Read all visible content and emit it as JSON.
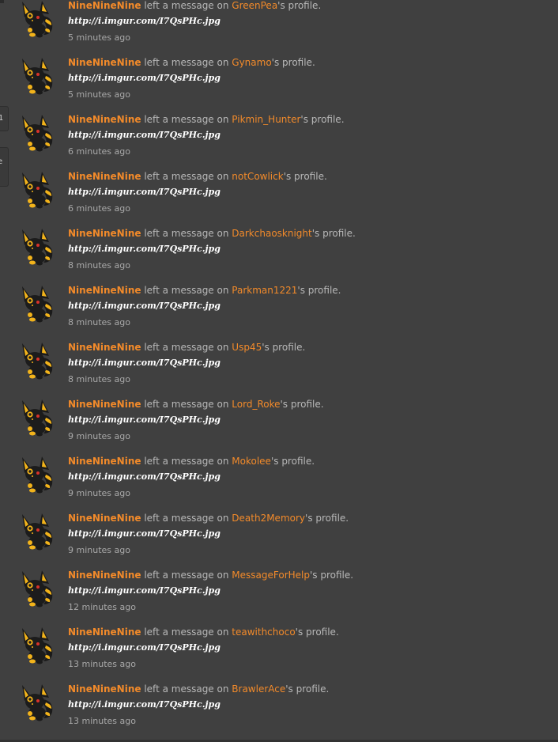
{
  "sidebar_fragments": {
    "tab1": "1",
    "tab2_line1": "e",
    "tab2_line2": ")"
  },
  "feed": [
    {
      "author": "NineNineNine",
      "action": "left a message on",
      "target": "GreenPea",
      "suffix": "'s profile.",
      "message": "http://i.imgur.com/I7QsPHc.jpg",
      "time": "5 minutes ago"
    },
    {
      "author": "NineNineNine",
      "action": "left a message on",
      "target": "Gynamo",
      "suffix": "'s profile.",
      "message": "http://i.imgur.com/I7QsPHc.jpg",
      "time": "5 minutes ago"
    },
    {
      "author": "NineNineNine",
      "action": "left a message on",
      "target": "Pikmin_Hunter",
      "suffix": "'s profile.",
      "message": "http://i.imgur.com/I7QsPHc.jpg",
      "time": "6 minutes ago"
    },
    {
      "author": "NineNineNine",
      "action": "left a message on",
      "target": "notCowlick",
      "suffix": "'s profile.",
      "message": "http://i.imgur.com/I7QsPHc.jpg",
      "time": "6 minutes ago"
    },
    {
      "author": "NineNineNine",
      "action": "left a message on",
      "target": "Darkchaosknight",
      "suffix": "'s profile.",
      "message": "http://i.imgur.com/I7QsPHc.jpg",
      "time": "8 minutes ago"
    },
    {
      "author": "NineNineNine",
      "action": "left a message on",
      "target": "Parkman1221",
      "suffix": "'s profile.",
      "message": "http://i.imgur.com/I7QsPHc.jpg",
      "time": "8 minutes ago"
    },
    {
      "author": "NineNineNine",
      "action": "left a message on",
      "target": "Usp45",
      "suffix": "'s profile.",
      "message": "http://i.imgur.com/I7QsPHc.jpg",
      "time": "8 minutes ago"
    },
    {
      "author": "NineNineNine",
      "action": "left a message on",
      "target": "Lord_Roke",
      "suffix": "'s profile.",
      "message": "http://i.imgur.com/I7QsPHc.jpg",
      "time": "9 minutes ago"
    },
    {
      "author": "NineNineNine",
      "action": "left a message on",
      "target": "Mokolee",
      "suffix": "'s profile.",
      "message": "http://i.imgur.com/I7QsPHc.jpg",
      "time": "9 minutes ago"
    },
    {
      "author": "NineNineNine",
      "action": "left a message on",
      "target": "Death2Memory",
      "suffix": "'s profile.",
      "message": "http://i.imgur.com/I7QsPHc.jpg",
      "time": "9 minutes ago"
    },
    {
      "author": "NineNineNine",
      "action": "left a message on",
      "target": "MessageForHelp",
      "suffix": "'s profile.",
      "message": "http://i.imgur.com/I7QsPHc.jpg",
      "time": "12 minutes ago"
    },
    {
      "author": "NineNineNine",
      "action": "left a message on",
      "target": "teawithchoco",
      "suffix": "'s profile.",
      "message": "http://i.imgur.com/I7QsPHc.jpg",
      "time": "13 minutes ago"
    },
    {
      "author": "NineNineNine",
      "action": "left a message on",
      "target": "BrawlerAce",
      "suffix": "'s profile.",
      "message": "http://i.imgur.com/I7QsPHc.jpg",
      "time": "13 minutes ago"
    }
  ],
  "avatar_icon": "umbreon-style-avatar-icon",
  "colors": {
    "background": "#404040",
    "link": "#f28a2a",
    "body_text": "#b8b8b8",
    "message_text": "#ffffff",
    "timestamp": "#a8a8a8"
  }
}
